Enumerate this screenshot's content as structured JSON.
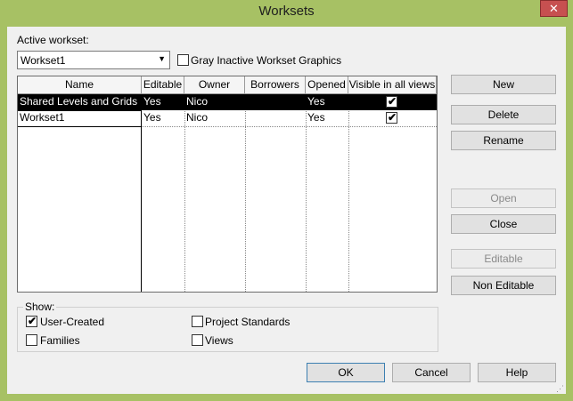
{
  "window": {
    "title": "Worksets",
    "close_glyph": "✕"
  },
  "active_workset": {
    "label": "Active workset:",
    "value": "Workset1"
  },
  "gray_inactive": {
    "label": "Gray Inactive Workset Graphics",
    "checked": false
  },
  "table": {
    "columns": [
      "Name",
      "Editable",
      "Owner",
      "Borrowers",
      "Opened",
      "Visible in all views"
    ],
    "rows": [
      {
        "name": "Shared Levels and Grids",
        "editable": "Yes",
        "owner": "Nico",
        "borrowers": "",
        "opened": "Yes",
        "visible": true,
        "selected": true
      },
      {
        "name": "Workset1",
        "editable": "Yes",
        "owner": "Nico",
        "borrowers": "",
        "opened": "Yes",
        "visible": true,
        "selected": false
      }
    ]
  },
  "side_buttons": {
    "new": "New",
    "delete": "Delete",
    "rename": "Rename",
    "open": "Open",
    "close": "Close",
    "editable": "Editable",
    "non_editable": "Non Editable"
  },
  "show": {
    "label": "Show:",
    "user_created": {
      "label": "User-Created",
      "checked": true
    },
    "families": {
      "label": "Families",
      "checked": false
    },
    "project_standards": {
      "label": "Project Standards",
      "checked": false
    },
    "views": {
      "label": "Views",
      "checked": false
    }
  },
  "footer": {
    "ok": "OK",
    "cancel": "Cancel",
    "help": "Help"
  },
  "check_glyph": "✔",
  "combo_arrow": "▼",
  "grip_glyph": "⋰"
}
